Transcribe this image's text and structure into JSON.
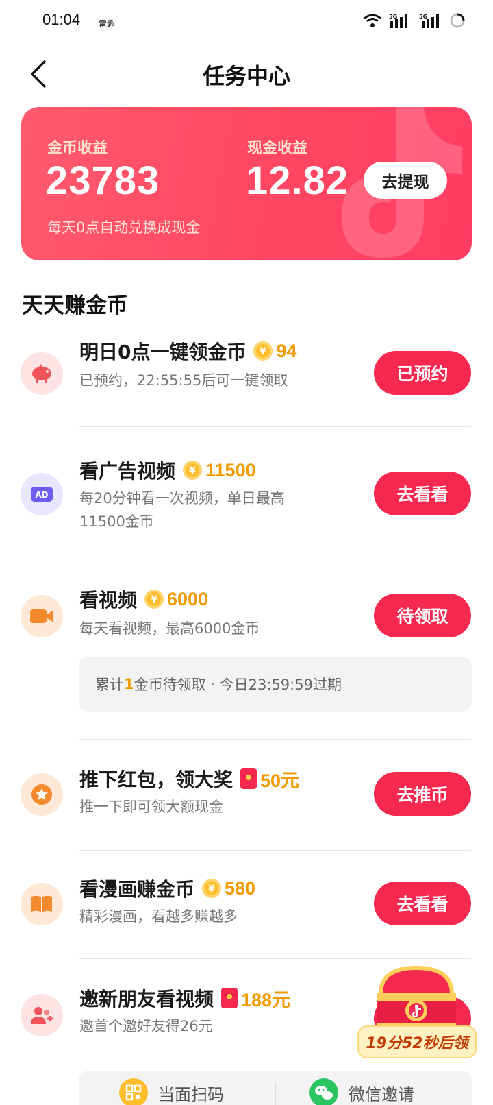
{
  "status_bar": {
    "time": "01:04",
    "app_badge": "雷趣"
  },
  "nav": {
    "title": "任务中心"
  },
  "earnings": {
    "coin_label": "金币收益",
    "coin_value": "23783",
    "coin_hint": "每天0点自动兑换成现金",
    "cash_label": "现金收益",
    "cash_value": "12.82",
    "withdraw_label": "去提现"
  },
  "section": {
    "title": "天天赚金币"
  },
  "tasks": [
    {
      "icon": "piggy-bank-icon",
      "title": "明日0点一键领金币",
      "reward_icon": "coin-icon",
      "reward": "94",
      "desc": "已预约，22:55:55后可一键领取",
      "button": "已预约"
    },
    {
      "icon": "ad-icon",
      "title": "看广告视频",
      "reward_icon": "coin-icon",
      "reward": "11500",
      "desc": "每20分钟看一次视频，单日最高11500金币",
      "button": "去看看"
    },
    {
      "icon": "video-camera-icon",
      "title": "看视频",
      "reward_icon": "coin-icon",
      "reward": "6000",
      "desc": "每天看视频，最高6000金币",
      "button": "待领取"
    },
    {
      "icon": "star-coin-icon",
      "title": "推下红包，领大奖",
      "reward_icon": "red-packet-icon",
      "reward": "50元",
      "desc": "推一下即可领大额现金",
      "button": "去推币"
    },
    {
      "icon": "book-icon",
      "title": "看漫画赚金币",
      "reward_icon": "coin-icon",
      "reward": "580",
      "desc": "精彩漫画，看越多赚越多",
      "button": "去看看"
    },
    {
      "icon": "invite-friends-icon",
      "title": "邀新朋友看视频",
      "reward_icon": "red-packet-icon",
      "reward": "188元",
      "desc": "邀首个邀好友得26元",
      "button": ""
    }
  ],
  "pending": {
    "prefix": "累计",
    "count": "1",
    "suffix": "金币待领取 · 今日23:59:59过期"
  },
  "invite": {
    "scan_label": "当面扫码",
    "wechat_label": "微信邀请"
  },
  "chest": {
    "timer": "19分52秒后领"
  },
  "colors": {
    "primary": "#f5294f",
    "gold": "#f29b00",
    "card_start": "#ff5a6e",
    "card_end": "#ff3d64"
  }
}
